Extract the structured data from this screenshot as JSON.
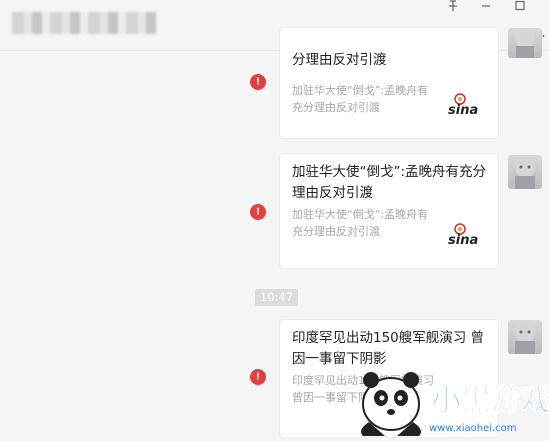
{
  "window": {
    "contact_name_blurred": true,
    "pin_icon": "pin-icon",
    "minimize_icon": "minimize-icon",
    "maximize_icon": "maximize-icon",
    "more_label": "..."
  },
  "messages": [
    {
      "title": "分理由反对引渡",
      "description": "加驻华大使“倒戈”:孟晚舟有充分理由反对引渡",
      "source_icon": "sina-logo",
      "status": "!"
    },
    {
      "title": "加驻华大使“倒戈”:孟晚舟有充分理由反对引渡",
      "description": "加驻华大使“倒戈”:孟晚舟有充分理由反对引渡",
      "source_icon": "sina-logo",
      "status": "!"
    },
    {
      "title": "印度罕见出动150艘军舰演习 曾因一事留下阴影",
      "description": "印度罕见出动150艘军舰演习 曾因一事留下阴影",
      "status": "!"
    }
  ],
  "timestamp": "10:47",
  "watermark": {
    "brand": "小黑游戏",
    "url": "www.xiaohei.com"
  },
  "colors": {
    "background": "#f5f5f5",
    "error_red": "#e24040",
    "sina_red": "#d52b2b",
    "title_text": "#222222",
    "desc_text": "#a7a7a7"
  }
}
